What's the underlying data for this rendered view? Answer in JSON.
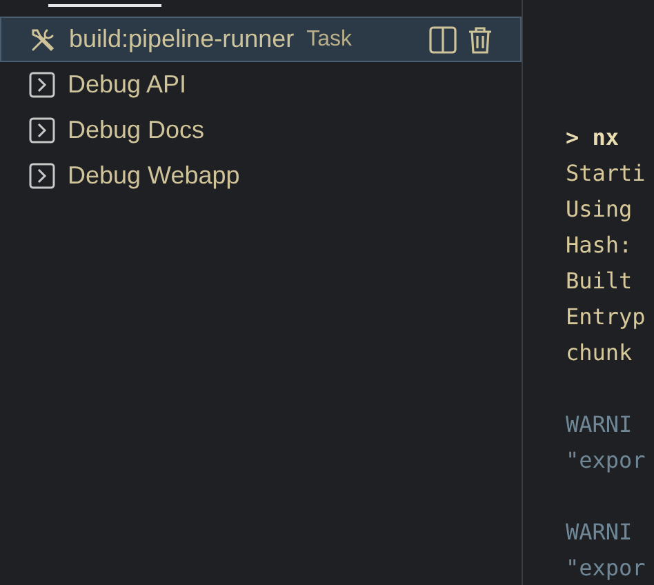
{
  "terminal_list": [
    {
      "kind": "task",
      "label": "build:pipeline-runner",
      "detail": "Task",
      "selected": true
    },
    {
      "kind": "debug",
      "label": "Debug API",
      "selected": false
    },
    {
      "kind": "debug",
      "label": "Debug Docs",
      "selected": false
    },
    {
      "kind": "debug",
      "label": "Debug Webapp",
      "selected": false
    }
  ],
  "terminal_lines": [
    {
      "kind": "command",
      "text": "> nx"
    },
    {
      "kind": "output",
      "text": "Starti"
    },
    {
      "kind": "output",
      "text": "Using"
    },
    {
      "kind": "output",
      "text": "Hash:"
    },
    {
      "kind": "output",
      "text": "Built"
    },
    {
      "kind": "output",
      "text": "Entryp"
    },
    {
      "kind": "output",
      "text": "chunk"
    },
    {
      "kind": "blank"
    },
    {
      "kind": "warning",
      "text": "WARNI"
    },
    {
      "kind": "warning",
      "text": "\"expor"
    },
    {
      "kind": "blank"
    },
    {
      "kind": "warning",
      "text": "WARNI"
    },
    {
      "kind": "warning",
      "text": "\"expor"
    }
  ]
}
